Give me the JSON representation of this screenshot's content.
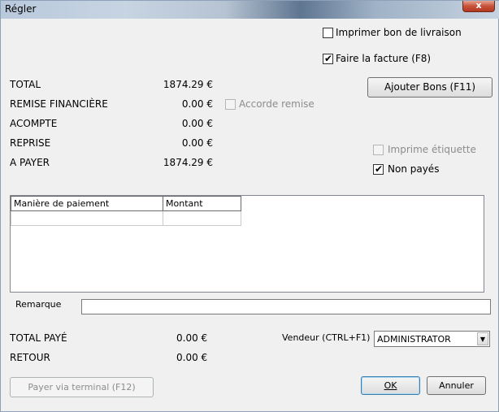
{
  "window": {
    "title": "Régler",
    "close_label": "x"
  },
  "options": {
    "print_delivery_note": {
      "label": "Imprimer bon de livraison",
      "checked": false
    },
    "make_invoice": {
      "label": "Faire la facture (F8)",
      "checked": true
    },
    "grant_discount": {
      "label": "Accorde remise",
      "checked": false,
      "enabled": false
    },
    "print_label": {
      "label": "Imprime étiquette",
      "checked": false,
      "enabled": false
    },
    "unpaid": {
      "label": "Non payés",
      "checked": true
    }
  },
  "buttons": {
    "add_notes": "Ajouter Bons (F11)",
    "pay_terminal": "Payer via terminal (F12)",
    "ok": "OK",
    "cancel": "Annuler"
  },
  "totals": [
    {
      "label": "TOTAL",
      "value": "1874.29 €"
    },
    {
      "label": "REMISE FINANCIÈRE",
      "value": "0.00 €"
    },
    {
      "label": "ACOMPTE",
      "value": "0.00 €"
    },
    {
      "label": "REPRISE",
      "value": "0.00 €"
    },
    {
      "label": "A PAYER",
      "value": "1874.29 €"
    }
  ],
  "payment_table": {
    "columns": [
      "Manière de paiement",
      "Montant"
    ],
    "rows": [
      [
        "",
        ""
      ]
    ]
  },
  "remark": {
    "label": "Remarque",
    "value": ""
  },
  "summary": {
    "total_paid_label": "TOTAL PAYÉ",
    "total_paid_value": "0.00 €",
    "return_label": "RETOUR",
    "return_value": "0.00 €"
  },
  "seller": {
    "label": "Vendeur (CTRL+F1)",
    "value": "ADMINISTRATOR"
  },
  "colors": {
    "title_gradient_dark": "#5f7691",
    "close_red": "#c8523a",
    "ok_border": "#3c7fb1"
  }
}
